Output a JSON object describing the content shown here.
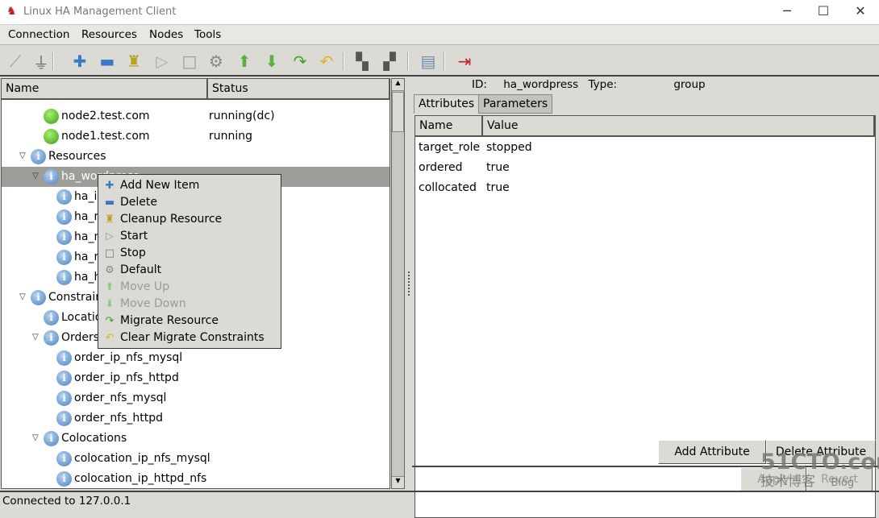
{
  "window": {
    "title": "Linux HA Management Client",
    "controls": [
      "─",
      "☐",
      "✕"
    ]
  },
  "menubar": [
    "Connection",
    "Resources",
    "Nodes",
    "Tools"
  ],
  "toolbar": [
    {
      "icon": "disconnect-icon",
      "glyph": "⟋",
      "color": "#999"
    },
    {
      "icon": "plug-icon",
      "glyph": "⏚",
      "color": "#666"
    },
    {
      "icon": "add-icon",
      "glyph": "✚",
      "color": "#3a78c8"
    },
    {
      "icon": "remove-icon",
      "glyph": "▬",
      "color": "#3a78c8"
    },
    {
      "icon": "cleanup-brush-icon",
      "glyph": "♜",
      "color": "#b8a020"
    },
    {
      "icon": "start-icon",
      "glyph": "▷",
      "color": "#aaa"
    },
    {
      "icon": "stop-icon",
      "glyph": "□",
      "color": "#999"
    },
    {
      "icon": "gear-icon",
      "glyph": "⚙",
      "color": "#888"
    },
    {
      "icon": "move-up-icon",
      "glyph": "⬆",
      "color": "#5cb040"
    },
    {
      "icon": "move-down-icon",
      "glyph": "⬇",
      "color": "#5cb040"
    },
    {
      "icon": "migrate-icon",
      "glyph": "↷",
      "color": "#40a020"
    },
    {
      "icon": "clear-migrate-icon",
      "glyph": "↶",
      "color": "#e0b020"
    },
    {
      "icon": "standby-node-icon",
      "glyph": "▚",
      "color": "#555"
    },
    {
      "icon": "active-node-icon",
      "glyph": "▞",
      "color": "#555"
    },
    {
      "icon": "document-icon",
      "glyph": "▤",
      "color": "#6a8ab0"
    },
    {
      "icon": "exit-icon",
      "glyph": "⇥",
      "color": "#c02020"
    }
  ],
  "tree": {
    "headers": {
      "name": "Name",
      "status": "Status"
    },
    "rows": [
      {
        "name": "node2.test.com",
        "status": "running(dc)",
        "level": 2,
        "toggle": false,
        "icon": "green"
      },
      {
        "name": "node1.test.com",
        "status": "running",
        "level": 2,
        "toggle": false,
        "icon": "green"
      },
      {
        "name": "Resources",
        "status": "",
        "level": 1,
        "toggle": true,
        "icon": "info"
      },
      {
        "name": "ha_wordpress",
        "status": "",
        "level": 2,
        "toggle": true,
        "icon": "info",
        "selected": true
      },
      {
        "name": "ha_ip",
        "status": "",
        "level": 3,
        "toggle": false,
        "icon": "info"
      },
      {
        "name": "ha_n",
        "status": "",
        "level": 3,
        "toggle": false,
        "icon": "info"
      },
      {
        "name": "ha_n",
        "status": "",
        "level": 3,
        "toggle": false,
        "icon": "info"
      },
      {
        "name": "ha_n",
        "status": "",
        "level": 3,
        "toggle": false,
        "icon": "info"
      },
      {
        "name": "ha_h",
        "status": "",
        "level": 3,
        "toggle": false,
        "icon": "info"
      },
      {
        "name": "Constraints",
        "status": "",
        "level": 1,
        "toggle": true,
        "icon": "info"
      },
      {
        "name": "Locations",
        "status": "",
        "level": 2,
        "toggle": false,
        "icon": "info"
      },
      {
        "name": "Orders",
        "status": "",
        "level": 2,
        "toggle": true,
        "icon": "info"
      },
      {
        "name": "order_ip_nfs_mysql",
        "status": "",
        "level": 3,
        "toggle": false,
        "icon": "info"
      },
      {
        "name": "order_ip_nfs_httpd",
        "status": "",
        "level": 3,
        "toggle": false,
        "icon": "info"
      },
      {
        "name": "order_nfs_mysql",
        "status": "",
        "level": 3,
        "toggle": false,
        "icon": "info"
      },
      {
        "name": "order_nfs_httpd",
        "status": "",
        "level": 3,
        "toggle": false,
        "icon": "info"
      },
      {
        "name": "Colocations",
        "status": "",
        "level": 2,
        "toggle": true,
        "icon": "info"
      },
      {
        "name": "colocation_ip_nfs_mysql",
        "status": "",
        "level": 3,
        "toggle": false,
        "icon": "info"
      },
      {
        "name": "colocation_ip_httpd_nfs",
        "status": "",
        "level": 3,
        "toggle": false,
        "icon": "info"
      }
    ]
  },
  "context_menu": [
    {
      "label": "Add New Item",
      "icon": "add-icon",
      "glyph": "✚",
      "color": "#3a78c8",
      "disabled": false
    },
    {
      "label": "Delete",
      "icon": "remove-icon",
      "glyph": "▬",
      "color": "#3a78c8",
      "disabled": false
    },
    {
      "label": "Cleanup Resource",
      "icon": "cleanup-brush-icon",
      "glyph": "♜",
      "color": "#b8a020",
      "disabled": false
    },
    {
      "label": "Start",
      "icon": "start-icon",
      "glyph": "▷",
      "color": "#999",
      "disabled": false
    },
    {
      "label": "Stop",
      "icon": "stop-icon",
      "glyph": "□",
      "color": "#777",
      "disabled": false
    },
    {
      "label": "Default",
      "icon": "gear-icon",
      "glyph": "⚙",
      "color": "#888",
      "disabled": false
    },
    {
      "label": "Move Up",
      "icon": "move-up-icon",
      "glyph": "⬆",
      "color": "#8c8",
      "disabled": true
    },
    {
      "label": "Move Down",
      "icon": "move-down-icon",
      "glyph": "⬇",
      "color": "#8c8",
      "disabled": true
    },
    {
      "label": "Migrate Resource",
      "icon": "migrate-icon",
      "glyph": "↷",
      "color": "#40a020",
      "disabled": false
    },
    {
      "label": "Clear Migrate Constraints",
      "icon": "clear-migrate-icon",
      "glyph": "↶",
      "color": "#e0b020",
      "disabled": false
    }
  ],
  "detail": {
    "id_label": "ID:",
    "id_value": "ha_wordpress",
    "type_label": "Type:",
    "type_value": "group",
    "tabs": [
      "Attributes",
      "Parameters"
    ],
    "table_headers": {
      "name": "Name",
      "value": "Value"
    },
    "attributes": [
      {
        "name": "target_role",
        "value": "stopped"
      },
      {
        "name": "ordered",
        "value": "true"
      },
      {
        "name": "collocated",
        "value": "true"
      }
    ],
    "add_attribute": "Add Attribute",
    "delete_attribute": "Delete Attribute",
    "apply": "Apply",
    "revert": "Revert"
  },
  "status": "Connected to 127.0.0.1",
  "watermark": {
    "line1": "51CTO.com",
    "line2": "技术博客",
    "line3": "Blog"
  }
}
